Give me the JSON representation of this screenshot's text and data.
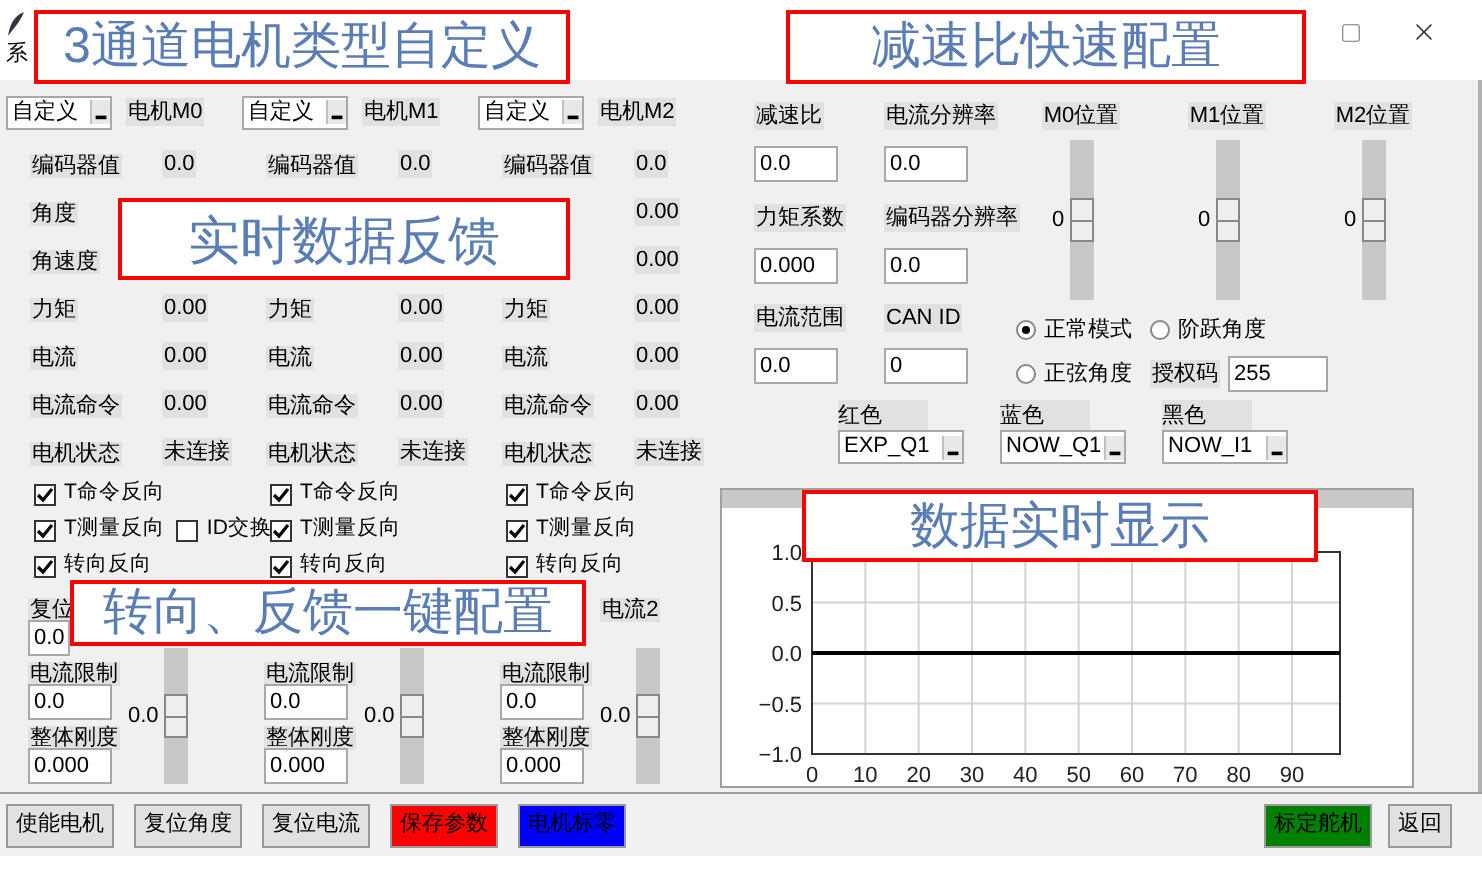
{
  "window": {
    "title": "系"
  },
  "motors": [
    {
      "type": "自定义",
      "name": "电机M0",
      "readings": [
        {
          "label": "编码器值",
          "value": "0.0"
        },
        {
          "label": "角度"
        },
        {
          "label": "角速度"
        },
        {
          "label": "力矩",
          "value": "0.00"
        },
        {
          "label": "电流",
          "value": "0.00"
        },
        {
          "label": "电流命令",
          "value": "0.00"
        },
        {
          "label": "电机状态",
          "value": "未连接"
        }
      ],
      "options": [
        {
          "label": "T命令反向",
          "checked": true
        },
        {
          "label": "T测量反向",
          "checked": true
        },
        {
          "label": "转向反向",
          "checked": true
        }
      ],
      "extra_option": {
        "label": "ID交换",
        "checked": false
      },
      "fields": [
        {
          "label": "复位",
          "value": "0.0"
        },
        {
          "label": "电流限制",
          "value": "0.0"
        },
        {
          "label": "整体刚度",
          "value": "0.000"
        }
      ],
      "slider": {
        "reading": "0.0",
        "level": 0.5
      }
    },
    {
      "type": "自定义",
      "name": "电机M1",
      "readings": [
        {
          "label": "编码器值",
          "value": "0.0"
        },
        {
          "covered": true
        },
        {
          "covered": true
        },
        {
          "label": "力矩",
          "value": "0.00"
        },
        {
          "label": "电流",
          "value": "0.00"
        },
        {
          "label": "电流命令",
          "value": "0.00"
        },
        {
          "label": "电机状态",
          "value": "未连接"
        }
      ],
      "options": [
        {
          "label": "T命令反向",
          "checked": true
        },
        {
          "label": "T测量反向",
          "checked": true
        },
        {
          "label": "转向反向",
          "checked": true
        }
      ],
      "fields": [
        {
          "covered": true
        },
        {
          "label": "电流限制",
          "value": "0.0"
        },
        {
          "label": "整体刚度",
          "value": "0.000"
        }
      ],
      "slider": {
        "reading": "0.0",
        "level": 0.5
      }
    },
    {
      "type": "自定义",
      "name": "电机M2",
      "readings": [
        {
          "label": "编码器值",
          "value": "0.0"
        },
        {
          "value": "0.00"
        },
        {
          "value": "0.00"
        },
        {
          "label": "力矩",
          "value": "0.00"
        },
        {
          "label": "电流",
          "value": "0.00"
        },
        {
          "label": "电流命令",
          "value": "0.00"
        },
        {
          "label": "电机状态",
          "value": "未连接"
        }
      ],
      "options": [
        {
          "label": "T命令反向",
          "checked": true
        },
        {
          "label": "T测量反向",
          "checked": true
        },
        {
          "label": "转向反向",
          "checked": true
        }
      ],
      "fields": [
        {
          "covered": true
        },
        {
          "label": "电流限制",
          "value": "0.0"
        },
        {
          "label": "整体刚度",
          "value": "0.000"
        }
      ],
      "slider": {
        "title": "电流2",
        "reading": "0.0",
        "level": 0.5
      }
    }
  ],
  "gear": {
    "fields": [
      {
        "label": "减速比",
        "value": "0.0"
      },
      {
        "label": "电流分辨率",
        "value": "0.0"
      },
      {
        "label": "力矩系数",
        "value": "0.000"
      },
      {
        "label": "编码器分辨率",
        "value": "0.0"
      },
      {
        "label": "电流范围",
        "value": "0.0"
      },
      {
        "label": "CAN ID",
        "value": "0"
      }
    ]
  },
  "positions": [
    {
      "label": "M0位置",
      "reading": "0",
      "level": 0.5
    },
    {
      "label": "M1位置",
      "reading": "0",
      "level": 0.5
    },
    {
      "label": "M2位置",
      "reading": "0",
      "level": 0.5
    }
  ],
  "modes": [
    {
      "label": "正常模式",
      "selected": true
    },
    {
      "label": "阶跃角度",
      "selected": false
    },
    {
      "label": "正弦角度",
      "selected": false
    }
  ],
  "auth": {
    "label": "授权码",
    "value": "255"
  },
  "channels": [
    {
      "label": "红色",
      "value": "EXP_Q1"
    },
    {
      "label": "蓝色",
      "value": "NOW_Q1"
    },
    {
      "label": "黑色",
      "value": "NOW_I1"
    }
  ],
  "chart": {
    "chart_data": {
      "type": "line",
      "grid": true,
      "x": [
        0,
        99
      ],
      "series": [
        {
          "color": "#000000",
          "values": [
            0,
            0
          ]
        }
      ],
      "xlim": [
        0,
        99
      ],
      "ylim": [
        -1,
        1
      ],
      "xticks": [
        0,
        10,
        20,
        30,
        40,
        50,
        60,
        70,
        80,
        90
      ],
      "yticks": [
        {
          "value": -1,
          "label": "−1.0"
        },
        {
          "value": -0.5,
          "label": "−0.5"
        },
        {
          "value": 0,
          "label": "0.0"
        },
        {
          "value": 0.5,
          "label": "0.5"
        },
        {
          "value": 1,
          "label": "1.0"
        }
      ]
    }
  },
  "buttons": [
    {
      "label": "使能电机"
    },
    {
      "label": "复位角度"
    },
    {
      "label": "复位电流"
    },
    {
      "label": "保存参数",
      "color": "#ff0000"
    },
    {
      "label": "电机标零",
      "color": "#0000ff"
    }
  ],
  "right_buttons": [
    {
      "label": "标定舵机",
      "color": "#008000"
    },
    {
      "label": "返回"
    }
  ],
  "callouts": [
    "3通道电机类型自定义",
    "减速比快速配置",
    "实时数据反馈",
    "数据实时显示",
    "转向、反馈一键配置"
  ]
}
